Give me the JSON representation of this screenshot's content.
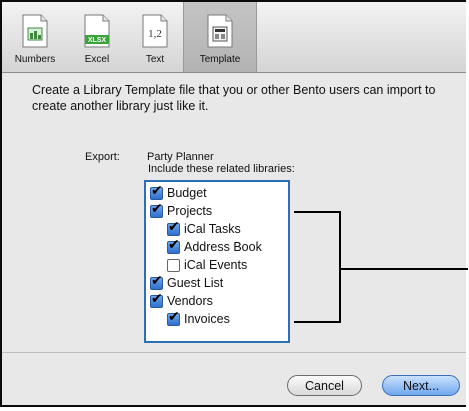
{
  "toolbar": {
    "items": [
      {
        "label": "Numbers",
        "icon": "numbers-icon"
      },
      {
        "label": "Excel",
        "icon": "excel-xlsx-icon",
        "badge": "XLSX"
      },
      {
        "label": "Text",
        "icon": "text-file-icon",
        "badge": "1,2"
      },
      {
        "label": "Template",
        "icon": "template-icon",
        "selected": true
      }
    ]
  },
  "content": {
    "description": "Create a Library Template file that you or other Bento users can import to create another library just like it.",
    "export_label": "Export:",
    "export_value": "Party Planner",
    "include_label": "Include these related libraries:"
  },
  "libraries": [
    {
      "label": "Budget",
      "checked": true,
      "level": 0
    },
    {
      "label": "Projects",
      "checked": true,
      "level": 0
    },
    {
      "label": "iCal Tasks",
      "checked": true,
      "level": 1
    },
    {
      "label": "Address Book",
      "checked": true,
      "level": 1
    },
    {
      "label": "iCal Events",
      "checked": false,
      "level": 1
    },
    {
      "label": "Guest List",
      "checked": true,
      "level": 0
    },
    {
      "label": "Vendors",
      "checked": true,
      "level": 0
    },
    {
      "label": "Invoices",
      "checked": true,
      "level": 1
    }
  ],
  "buttons": {
    "cancel": "Cancel",
    "next": "Next..."
  },
  "colors": {
    "accent": "#2e6fcf",
    "window_bg": "#e8e8e8"
  }
}
